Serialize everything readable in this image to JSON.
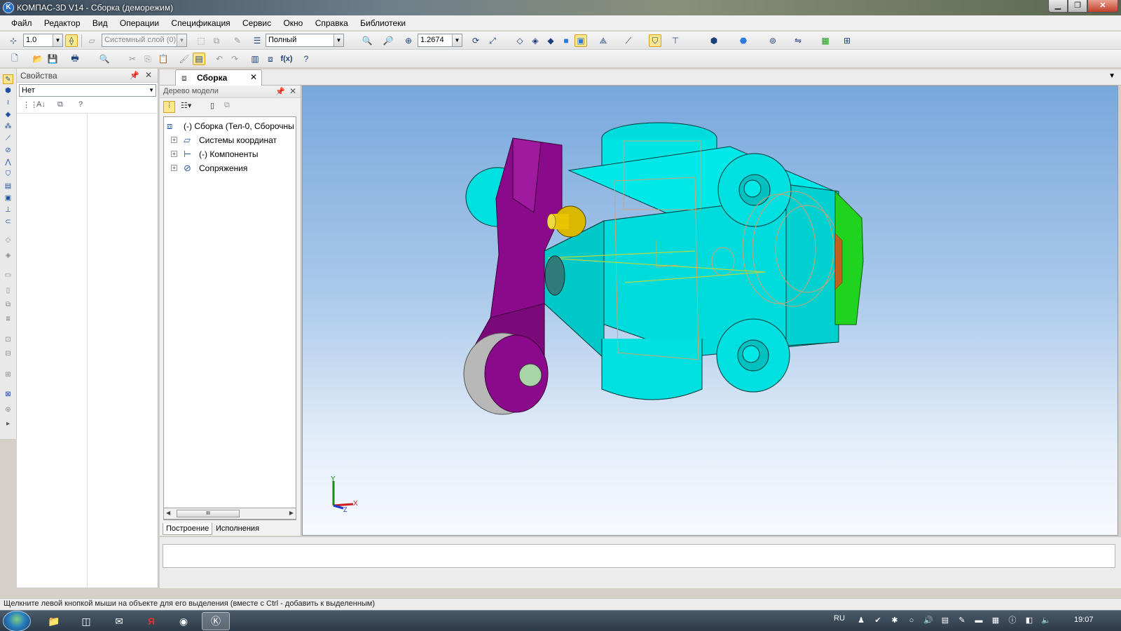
{
  "window": {
    "title": "КОМПАС-3D V14 - Сборка (деморежим)",
    "app_icon": "K"
  },
  "menu": [
    "Файл",
    "Редактор",
    "Вид",
    "Операции",
    "Спецификация",
    "Сервис",
    "Окно",
    "Справка",
    "Библиотеки"
  ],
  "toolbar": {
    "step_value": "1.0",
    "layer_value": "Системный слой (0)",
    "view_mode": "Полный",
    "zoom_value": "1.2674",
    "fx_label": "f(x)"
  },
  "properties": {
    "header": "Свойства",
    "selection": "Нет"
  },
  "document_tab": {
    "label": "Сборка"
  },
  "model_tree": {
    "header": "Дерево модели",
    "root": "(-) Сборка (Тел-0, Сборочны",
    "children": [
      "Системы координат",
      "(-) Компоненты",
      "Сопряжения"
    ],
    "bottom_tabs": [
      "Построение",
      "Исполнения"
    ]
  },
  "viewport": {
    "axis_x": "X",
    "axis_y": "Y",
    "axis_z": "Z"
  },
  "status": {
    "text": "Щелкните левой кнопкой мыши на объекте для его выделения (вместе с Ctrl - добавить к выделенным)"
  },
  "taskbar": {
    "lang": "RU",
    "clock": "19:07"
  },
  "colors": {
    "body_cyan": "#00e6e6",
    "lever_purple": "#8b0a8b",
    "end_green": "#1fd31f",
    "pin_yellow": "#e8c400",
    "wheel_gray": "#c8c8c8"
  }
}
